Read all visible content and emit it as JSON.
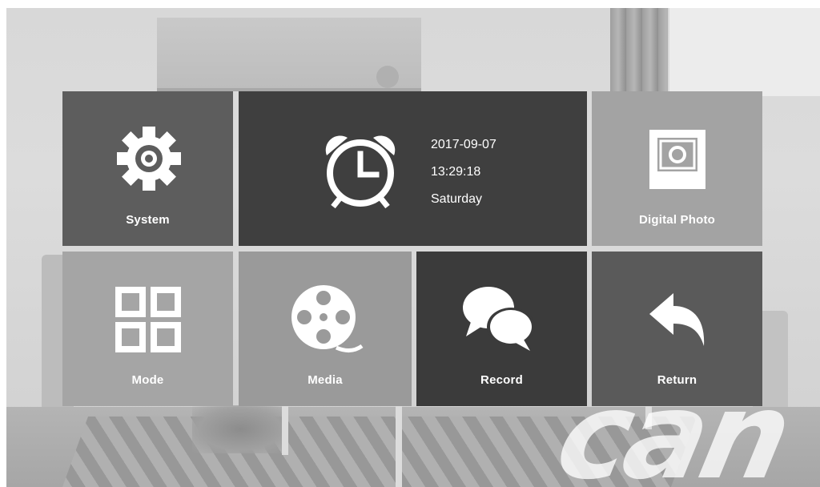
{
  "menu": {
    "system": {
      "label": "System",
      "icon": "gear-icon"
    },
    "datetime": {
      "date": "2017-09-07",
      "time": "13:29:18",
      "weekday": "Saturday",
      "icon": "alarm-clock-icon"
    },
    "digital_photo": {
      "label": "Digital Photo",
      "icon": "photo-frame-icon"
    },
    "mode": {
      "label": "Mode",
      "icon": "grid-icon"
    },
    "media": {
      "label": "Media",
      "icon": "film-reel-icon"
    },
    "record": {
      "label": "Record",
      "icon": "chat-bubbles-icon"
    },
    "return": {
      "label": "Return",
      "icon": "return-arrow-icon"
    }
  },
  "watermark": {
    "text": "can"
  },
  "colors": {
    "tile_dark": "#3f3f3f",
    "tile_mid": "#5d5d5d",
    "tile_light": "#a4a4a4",
    "text": "#ffffff"
  }
}
